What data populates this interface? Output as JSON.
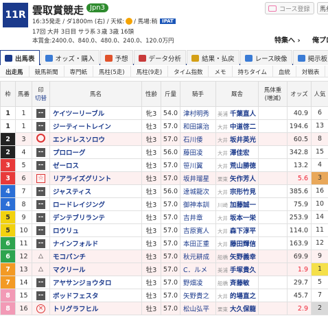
{
  "race": {
    "number": "11R",
    "name": "雲取賞競走",
    "grade": "Jpn3",
    "info_line1": "16:35発走 / ダ1800m (右) / 天候:",
    "info_track": "/ 馬場:稍",
    "ipat": "IPAT",
    "info_line2": "17回 大井 3日目 サラ系３歳 3歳      16頭",
    "info_line3": "本賞金:2400.0、840.0、480.0、240.0、120.0万円"
  },
  "header_buttons": {
    "register": "コース登録",
    "bet": "馬券",
    "special": "特集へ ›",
    "next": "俺プロ"
  },
  "tabs": [
    {
      "label": "出馬表",
      "color": "#1b3a8c",
      "active": true
    },
    {
      "label": "オッズ・購入",
      "color": "#3a7bd5",
      "active": false
    },
    {
      "label": "予想",
      "color": "#e0522b",
      "active": false
    },
    {
      "label": "データ分析",
      "color": "#c83a3a",
      "active": false
    },
    {
      "label": "結果・払戻",
      "color": "#d4a017",
      "active": false
    },
    {
      "label": "レース映像",
      "color": "#3a7bd5",
      "active": false
    },
    {
      "label": "掲示板",
      "color": "#3a7bd5",
      "active": false
    }
  ],
  "subtabs": [
    "出走馬",
    "競馬新聞",
    "専門紙",
    "馬柱(5走)",
    "馬柱(9走)",
    "タイム指数",
    "メモ",
    "持ちタイム",
    "血統",
    "対戦表"
  ],
  "columns": {
    "frame": "枠",
    "number": "馬番",
    "mark": "印",
    "mark_sub": "切替",
    "horse": "馬名",
    "sex_age": "性齢",
    "weight": "斤量",
    "jockey": "騎手",
    "trainer": "厩舎",
    "body": "馬体重",
    "body_sub": "(増減)",
    "odds": "オッズ",
    "pop": "人気"
  },
  "frame_colors": {
    "1": "#ffffff",
    "2": "#222222",
    "3": "#e83a3a",
    "4": "#2b6fd6",
    "5": "#f2d20f",
    "6": "#2ea44f",
    "7": "#f39a24",
    "8": "#f29ab6"
  },
  "horses": [
    {
      "frame": "1",
      "num": "1",
      "mark": "dash",
      "mark_text": "--",
      "name": "ケイツーリーブル",
      "sex": "牝3",
      "kg": "54.0",
      "jockey": "津村明秀",
      "area": "美浦",
      "trainer": "千葉直人",
      "odds": "40.9",
      "hot": false,
      "pop": "6"
    },
    {
      "frame": "1",
      "num": "1",
      "mark": "dash",
      "mark_text": "--",
      "name": "ジーティートレイン",
      "sex": "牡3",
      "kg": "57.0",
      "jockey": "和田譲治",
      "area": "大井",
      "trainer": "中道啓二",
      "odds": "194.6",
      "hot": false,
      "pop": "13"
    },
    {
      "frame": "2",
      "num": "3",
      "mark": "circle",
      "mark_text": "",
      "name": "エンドレスソロウ",
      "sex": "牡3",
      "kg": "57.0",
      "jockey": "石川倭",
      "area": "大井",
      "trainer": "坂井英光",
      "odds": "60.5",
      "hot": false,
      "pop": "8"
    },
    {
      "frame": "2",
      "num": "4",
      "mark": "dash",
      "mark_text": "--",
      "name": "プロローグ",
      "sex": "牡3",
      "kg": "56.0",
      "jockey": "藤田凌",
      "area": "大井",
      "trainer": "澤佳宏",
      "odds": "342.8",
      "hot": false,
      "pop": "15"
    },
    {
      "frame": "3",
      "num": "5",
      "mark": "dash",
      "mark_text": "--",
      "name": "ゼーロス",
      "sex": "牡3",
      "kg": "57.0",
      "jockey": "笹川翼",
      "area": "大井",
      "trainer": "荒山勝徳",
      "odds": "13.2",
      "hot": false,
      "pop": "4"
    },
    {
      "frame": "3",
      "num": "6",
      "mark": "star",
      "mark_text": "☆",
      "name": "リアライズグリント",
      "sex": "牡3",
      "kg": "57.0",
      "jockey": "坂井瑠星",
      "area": "栗東",
      "trainer": "矢作芳人",
      "odds": "5.6",
      "hot": true,
      "pop": "3"
    },
    {
      "frame": "4",
      "num": "7",
      "mark": "dash",
      "mark_text": "--",
      "name": "ジャスティス",
      "sex": "牡3",
      "kg": "56.0",
      "jockey": "達城龍次",
      "area": "大井",
      "trainer": "宗形竹見",
      "odds": "385.6",
      "hot": false,
      "pop": "16"
    },
    {
      "frame": "4",
      "num": "8",
      "mark": "dash",
      "mark_text": "--",
      "name": "ロードレイジング",
      "sex": "牡3",
      "kg": "57.0",
      "jockey": "御神本訓",
      "area": "川崎",
      "trainer": "加藤誠一",
      "odds": "75.9",
      "hot": false,
      "pop": "10"
    },
    {
      "frame": "5",
      "num": "9",
      "mark": "dash",
      "mark_text": "--",
      "name": "デンテブリランテ",
      "sex": "牡3",
      "kg": "57.0",
      "jockey": "吉井章",
      "area": "大井",
      "trainer": "坂本一栄",
      "odds": "253.9",
      "hot": false,
      "pop": "14"
    },
    {
      "frame": "5",
      "num": "10",
      "mark": "dash",
      "mark_text": "--",
      "name": "ロウリュ",
      "sex": "牡3",
      "kg": "57.0",
      "jockey": "吉原寛人",
      "area": "大井",
      "trainer": "森下淳平",
      "odds": "114.0",
      "hot": false,
      "pop": "11"
    },
    {
      "frame": "6",
      "num": "11",
      "mark": "dash",
      "mark_text": "--",
      "name": "ナインフォルド",
      "sex": "牡3",
      "kg": "57.0",
      "jockey": "本田正重",
      "area": "大井",
      "trainer": "藤田輝信",
      "odds": "163.9",
      "hot": false,
      "pop": "12"
    },
    {
      "frame": "6",
      "num": "12",
      "mark": "triangle",
      "mark_text": "△",
      "name": "モコパンチ",
      "sex": "牡3",
      "kg": "57.0",
      "jockey": "秋元耕成",
      "area": "船橋",
      "trainer": "矢野義幸",
      "odds": "69.9",
      "hot": false,
      "pop": "9"
    },
    {
      "frame": "7",
      "num": "13",
      "mark": "triangle",
      "mark_text": "△",
      "name": "マクリール",
      "sex": "牡3",
      "kg": "57.0",
      "jockey": "C．ルメ",
      "area": "美浦",
      "trainer": "手塚貴久",
      "odds": "1.9",
      "hot": true,
      "pop": "1"
    },
    {
      "frame": "7",
      "num": "14",
      "mark": "dash",
      "mark_text": "--",
      "name": "アヤサンジョウタロ",
      "sex": "牡3",
      "kg": "57.0",
      "jockey": "野畑凌",
      "area": "船橋",
      "trainer": "斉藤敏",
      "odds": "29.7",
      "hot": false,
      "pop": "5"
    },
    {
      "frame": "8",
      "num": "15",
      "mark": "dash",
      "mark_text": "--",
      "name": "ボッドフェスタ",
      "sex": "牡3",
      "kg": "57.0",
      "jockey": "矢野貴之",
      "area": "大井",
      "trainer": "的場直之",
      "odds": "45.7",
      "hot": false,
      "pop": "7"
    },
    {
      "frame": "8",
      "num": "16",
      "mark": "x",
      "mark_text": "×",
      "name": "トリグラフヒル",
      "sex": "牡3",
      "kg": "57.0",
      "jockey": "松山弘平",
      "area": "栗東",
      "trainer": "大久保龍",
      "odds": "2.9",
      "hot": true,
      "pop": "2"
    }
  ]
}
